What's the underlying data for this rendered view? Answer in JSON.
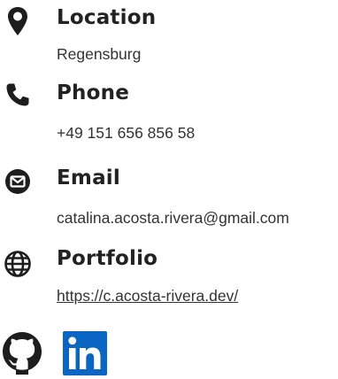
{
  "contacts": {
    "location": {
      "label": "Location",
      "value": "Regensburg",
      "icon": "map-pin-icon"
    },
    "phone": {
      "label": "Phone",
      "value": "+49 151 656 856 58",
      "icon": "phone-icon"
    },
    "email": {
      "label": "Email",
      "value": "catalina.acosta.rivera@gmail.com",
      "icon": "envelope-icon"
    },
    "portfolio": {
      "label": "Portfolio",
      "value": "https://c.acosta-rivera.dev/",
      "icon": "globe-icon"
    }
  },
  "social": {
    "github": {
      "icon": "github-icon"
    },
    "linkedin": {
      "icon": "linkedin-icon",
      "color": "#0a66c2"
    }
  },
  "colors": {
    "text": "#222222",
    "icon": "#1d1d1d",
    "linkedin": "#0a66c2"
  }
}
